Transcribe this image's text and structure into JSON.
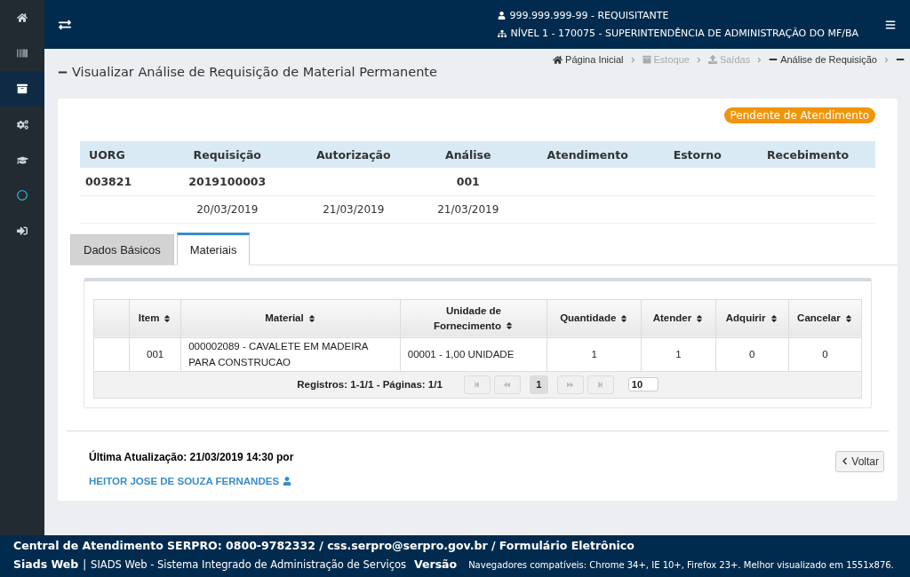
{
  "sidebar": {
    "items": [
      {
        "kind": "home",
        "selected": false
      },
      {
        "kind": "barcode",
        "selected": false
      },
      {
        "kind": "archive",
        "selected": true
      },
      {
        "kind": "cogs",
        "selected": false
      },
      {
        "kind": "cap",
        "selected": false
      },
      {
        "kind": "circle",
        "selected": false
      },
      {
        "kind": "signin",
        "selected": false
      }
    ]
  },
  "header": {
    "user": "999.999.999-99 - REQUISITANTE",
    "unit": "NÍVEL 1 - 170075 - SUPERINTENDÊNCIA DE ADMINISTRAÇÃO DO MF/BA"
  },
  "page_title": "Visualizar Análise de Requisição de Material Permanente",
  "breadcrumb": [
    {
      "label": "Página Inicial",
      "kind": "home",
      "disabled": false
    },
    {
      "label": "Estoque",
      "kind": "archive",
      "disabled": true
    },
    {
      "label": "Saídas",
      "kind": "upload",
      "disabled": true
    },
    {
      "label": "Análise de Requisição",
      "kind": "minus",
      "disabled": false
    }
  ],
  "status_badge": "Pendente de Atendimento",
  "summary": {
    "columns": [
      "UORG",
      "Requisição",
      "Autorização",
      "Análise",
      "Atendimento",
      "Estorno",
      "Recebimento"
    ],
    "rows": [
      [
        "003821",
        "2019100003",
        "",
        "001",
        "",
        "",
        ""
      ],
      [
        "",
        "20/03/2019",
        "21/03/2019",
        "21/03/2019",
        "",
        "",
        ""
      ]
    ]
  },
  "tabs": [
    {
      "label": "Dados Básicos",
      "selected": false
    },
    {
      "label": "Materiais",
      "selected": true
    }
  ],
  "table": {
    "columns": [
      "",
      "Item",
      "Material",
      "Unidade de Fornecimento",
      "Quantidade",
      "Atender",
      "Adquirir",
      "Cancelar"
    ],
    "rows": [
      [
        "",
        "001",
        "000002089 - CAVALETE EM MADEIRA PARA CONSTRUCAO",
        "00001 - 1,00 UNIDADE",
        "1",
        "1",
        "0",
        "0"
      ]
    ],
    "pagination": {
      "summary": "Registros: 1-1/1 - Páginas: 1/1",
      "page": "1",
      "page_size": "10"
    }
  },
  "last_update": {
    "label": "Última Atualização: 21/03/2019 14:30 por",
    "user": "HEITOR JOSE DE SOUZA FERNANDES"
  },
  "back_button": "Voltar",
  "footer": {
    "contact": "Central de Atendimento SERPRO: 0800-9782332 / css.serpro@serpro.gov.br / Formulário Eletrônico",
    "app": "Siads Web",
    "separator": "|",
    "system": "SIADS Web - Sistema Integrado de Administração de Serviços",
    "version": "Versão",
    "browsers": "Navegadores compatíveis: Chrome 34+, IE 10+, Firefox 23+. Melhor visualizado em 1551x876."
  }
}
